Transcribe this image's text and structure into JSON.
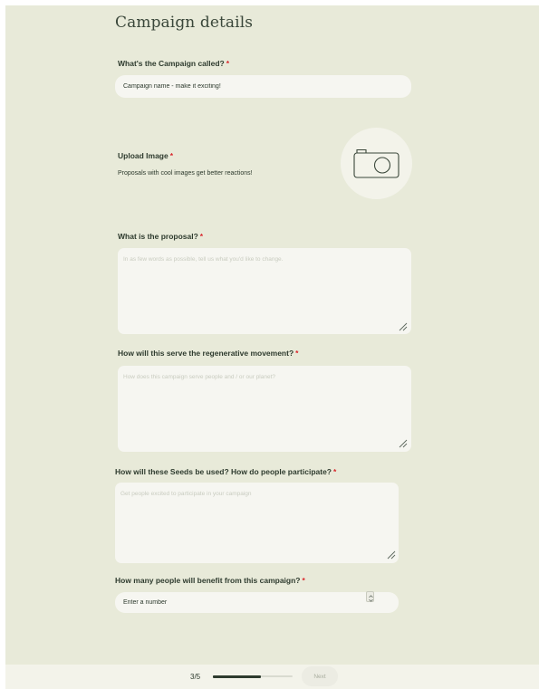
{
  "page": {
    "title": "Campaign details"
  },
  "fields": {
    "campaign_name": {
      "label": "What's the Campaign called?",
      "required": "*",
      "placeholder": "Campaign name - make it exciting!"
    },
    "upload_image": {
      "label": "Upload Image",
      "required": "*",
      "hint": "Proposals with cool images get better reactions!",
      "icon": "camera-icon"
    },
    "proposal": {
      "label": "What is the proposal?",
      "required": "*",
      "placeholder": "In as few words as possible, tell us what you'd like to change."
    },
    "regenerative": {
      "label": "How will this serve the regenerative movement?",
      "required": "*",
      "placeholder": "How does this campaign serve people and / or our planet?"
    },
    "seeds_usage": {
      "label": "How will these Seeds be used? How do people participate?",
      "required": "*",
      "placeholder": "Get people excited to participate in your campaign"
    },
    "beneficiaries": {
      "label": "How many people will benefit from this campaign?",
      "required": "*",
      "placeholder": "Enter a number"
    }
  },
  "footer": {
    "step": "3/5",
    "progress": 0.6,
    "next_label": "Next"
  },
  "colors": {
    "background": "#e8ead9",
    "input": "#f6f6f1",
    "required": "#d9262b",
    "text": "#2e3b2e"
  }
}
